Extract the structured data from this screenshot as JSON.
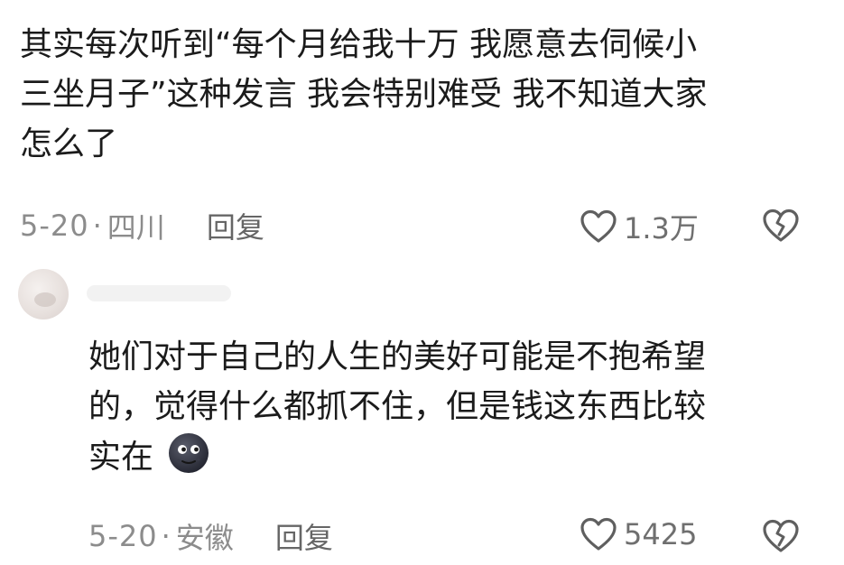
{
  "comments": [
    {
      "text_lines": [
        "其实每次听到“每个月给我十万 我愿意去伺候小",
        "三坐月子”这种发言 我会特别难受 我不知道大家",
        "怎么了"
      ],
      "date": "5-20",
      "separator": "·",
      "location": "四川",
      "reply_label": "回复",
      "like_count": "1.3万"
    },
    {
      "text_lines": [
        "她们对于自己的人生的美好可能是不抱希望",
        "的，觉得什么都抓不住，但是钱这东西比较",
        "实在"
      ],
      "emoji": "smiling-moon-emoji",
      "date": "5-20",
      "separator": "·",
      "location": "安徽",
      "reply_label": "回复",
      "like_count": "5425"
    }
  ],
  "icons": {
    "like": "heart-outline-icon",
    "dislike": "broken-heart-icon"
  },
  "colors": {
    "text": "#1b1b1b",
    "meta": "#8c8c8c",
    "icon": "#5f5f5f"
  }
}
